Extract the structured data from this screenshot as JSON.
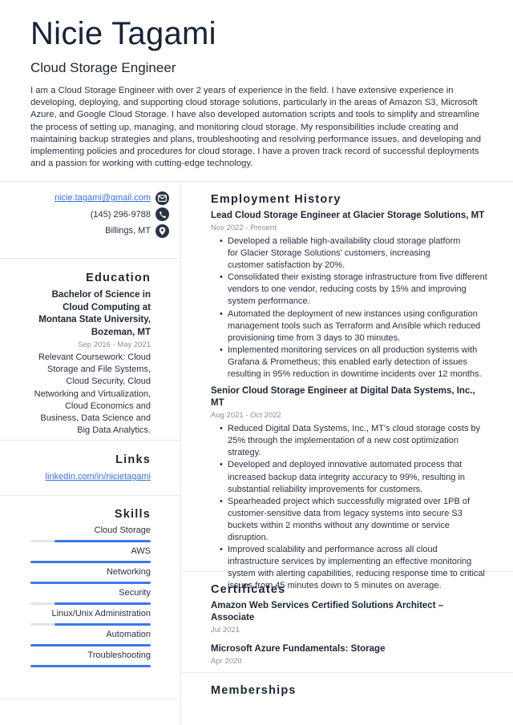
{
  "header": {
    "name": "Nicie Tagami",
    "title": "Cloud Storage Engineer",
    "summary": "I am a Cloud Storage Engineer with over 2 years of experience in the field. I have extensive experience in developing, deploying, and supporting cloud storage solutions, particularly in the areas of Amazon S3, Microsoft Azure, and Google Cloud Storage. I have also developed automation scripts and tools to simplify and streamline the process of setting up, managing, and monitoring cloud storage. My responsibilities include creating and maintaining backup strategies and plans, troubleshooting and resolving performance issues, and developing and implementing policies and procedures for cloud storage. I have a proven track record of successful deployments and a passion for working with cutting-edge technology."
  },
  "contact": {
    "email": "nicie.tagami@gmail.com",
    "email_icon": "envelope-icon",
    "phone": "(145) 296-9788",
    "phone_icon": "phone-icon",
    "location": "Billings, MT",
    "location_icon": "map-pin-icon"
  },
  "education": {
    "title": "Education",
    "degree": "Bachelor of Science in Cloud Computing at Montana State University, Bozeman, MT",
    "dates": "Sep 2016 - May 2021",
    "description": "Relevant Coursework: Cloud Storage and File Systems, Cloud Security, Cloud Networking and Virtualization, Cloud Economics and Business, Data Science and Big Data Analytics."
  },
  "links": {
    "title": "Links",
    "items": [
      {
        "label": "linkedin.com/in/nicietagami"
      }
    ]
  },
  "skills": {
    "title": "Skills",
    "items": [
      {
        "name": "Cloud Storage",
        "level": 0.8
      },
      {
        "name": "AWS",
        "level": 1.0
      },
      {
        "name": "Networking",
        "level": 1.0
      },
      {
        "name": "Security",
        "level": 0.8
      },
      {
        "name": "Linux/Unix Administration",
        "level": 0.8
      },
      {
        "name": "Automation",
        "level": 1.0
      },
      {
        "name": "Troubleshooting",
        "level": 1.0
      }
    ]
  },
  "employment": {
    "title": "Employment History",
    "jobs": [
      {
        "heading": "Lead Cloud Storage Engineer at Glacier Storage Solutions, MT",
        "dates": "Nov 2022 - Present",
        "bullets": [
          "Developed a reliable high-availability cloud storage platform for Glacier Storage Solutions' customers, increasing customer satisfaction by 20%.",
          "Consolidated their existing storage infrastructure from five different vendors to one vendor, reducing costs by 15% and improving system performance.",
          "Automated the deployment of new instances using configuration management tools such as Terraform and Ansible which reduced provisioning time from 3 days to 30 minutes.",
          "Implemented monitoring services on all production systems with Grafana & Prometheus; this enabled early detection of issues resulting in 95% reduction in downtime incidents over 12 months."
        ]
      },
      {
        "heading": "Senior Cloud Storage Engineer at Digital Data Systems, Inc., MT",
        "dates": "Aug 2021 - Oct 2022",
        "bullets": [
          "Reduced Digital Data Systems, Inc., MT's cloud storage costs by 25% through the implementation of a new cost optimization strategy.",
          "Developed and deployed innovative automated process that increased backup data integrity accuracy to 99%, resulting in substantial reliability improvements for customers.",
          "Spearheaded project which successfully migrated over 1PB of customer-sensitive data from legacy systems into secure S3 buckets within 2 months without any downtime or service disruption.",
          "Improved scalability and performance across all cloud infrastructure services by implementing an effective monitoring system with alerting capabilities, reducing response time to critical issues from 45 minutes down to 5 minutes on average."
        ]
      }
    ]
  },
  "certificates": {
    "title": "Certificates",
    "items": [
      {
        "name": "Amazon Web Services Certified Solutions Architect – Associate",
        "date": "Jul 2021"
      },
      {
        "name": "Microsoft Azure Fundamentals: Storage",
        "date": "Apr 2020"
      }
    ]
  },
  "memberships": {
    "title": "Memberships"
  },
  "colors": {
    "accent": "#3b78e7",
    "link": "#3a6fd8",
    "text": "#1e2532",
    "muted": "#8a8f98",
    "divider": "#e6e8eb",
    "icon_bg": "#2b3342"
  }
}
